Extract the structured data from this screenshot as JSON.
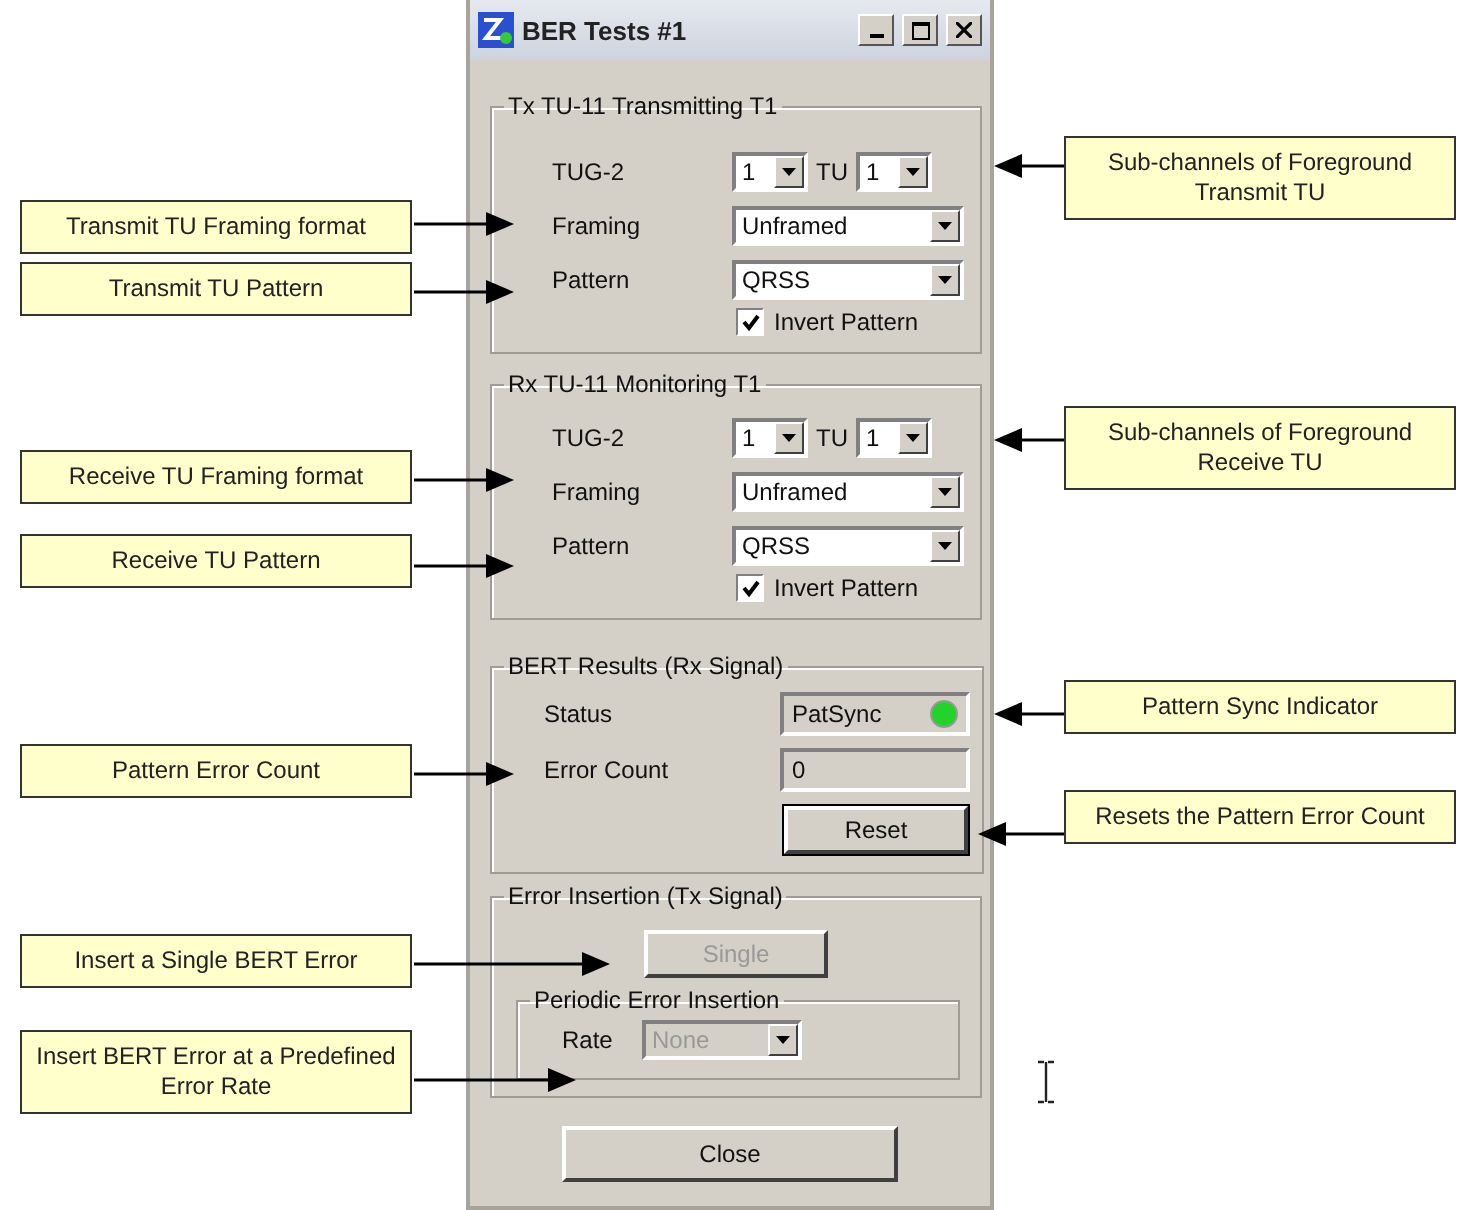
{
  "window": {
    "title": "BER Tests #1"
  },
  "tx_group": {
    "title": "Tx TU-11 Transmitting T1",
    "tug2_label": "TUG-2",
    "tug2_value": "1",
    "tu_label": "TU",
    "tu_value": "1",
    "framing_label": "Framing",
    "framing_value": "Unframed",
    "pattern_label": "Pattern",
    "pattern_value": "QRSS",
    "invert_pattern": {
      "label": "Invert Pattern",
      "checked": true
    }
  },
  "rx_group": {
    "title": "Rx TU-11 Monitoring T1",
    "tug2_label": "TUG-2",
    "tug2_value": "1",
    "tu_label": "TU",
    "tu_value": "1",
    "framing_label": "Framing",
    "framing_value": "Unframed",
    "pattern_label": "Pattern",
    "pattern_value": "QRSS",
    "invert_pattern": {
      "label": "Invert Pattern",
      "checked": true
    }
  },
  "bert_results": {
    "title": "BERT Results (Rx Signal)",
    "status_label": "Status",
    "status_value": "PatSync",
    "sync": true,
    "error_count_label": "Error Count",
    "error_count": "0",
    "reset_button": "Reset"
  },
  "error_insertion": {
    "title": "Error Insertion (Tx Signal)",
    "single_button": {
      "label": "Single",
      "disabled": true
    },
    "periodic": {
      "title": "Periodic Error Insertion",
      "rate_label": "Rate",
      "rate_value": "None",
      "disabled": true
    }
  },
  "close_button": "Close",
  "left_callouts": [
    "Transmit TU Framing format",
    "Transmit TU Pattern",
    "Receive TU Framing format",
    "Receive TU Pattern",
    "Pattern Error Count",
    "Insert a Single BERT Error",
    "Insert BERT Error at a Predefined Error Rate"
  ],
  "right_callouts": [
    "Sub-channels of Foreground Transmit TU",
    "Sub-channels of Foreground Receive TU",
    "Pattern Sync Indicator",
    "Resets the Pattern Error Count"
  ]
}
